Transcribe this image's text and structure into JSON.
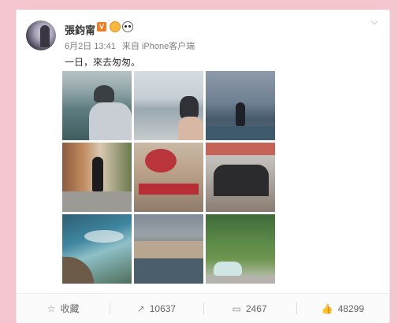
{
  "post": {
    "username": "張鈞甯",
    "vip_label": "V",
    "date": "6月2日 13:41",
    "source": "来自 iPhone客户端",
    "text": "一日，來去匆匆。"
  },
  "photos": [
    {
      "name": "photo-1"
    },
    {
      "name": "photo-2"
    },
    {
      "name": "photo-3"
    },
    {
      "name": "photo-4"
    },
    {
      "name": "photo-5"
    },
    {
      "name": "photo-6"
    },
    {
      "name": "photo-7"
    },
    {
      "name": "photo-8"
    },
    {
      "name": "photo-9"
    }
  ],
  "actions": {
    "favorite": {
      "label": "收藏",
      "icon": "star-icon"
    },
    "repost": {
      "count": "10637",
      "icon": "repost-icon"
    },
    "comment": {
      "count": "2467",
      "icon": "comment-icon"
    },
    "like": {
      "count": "48299",
      "icon": "thumbs-up-icon"
    }
  },
  "colors": {
    "background": "#f6c6d0",
    "vip": "#f07b22"
  }
}
